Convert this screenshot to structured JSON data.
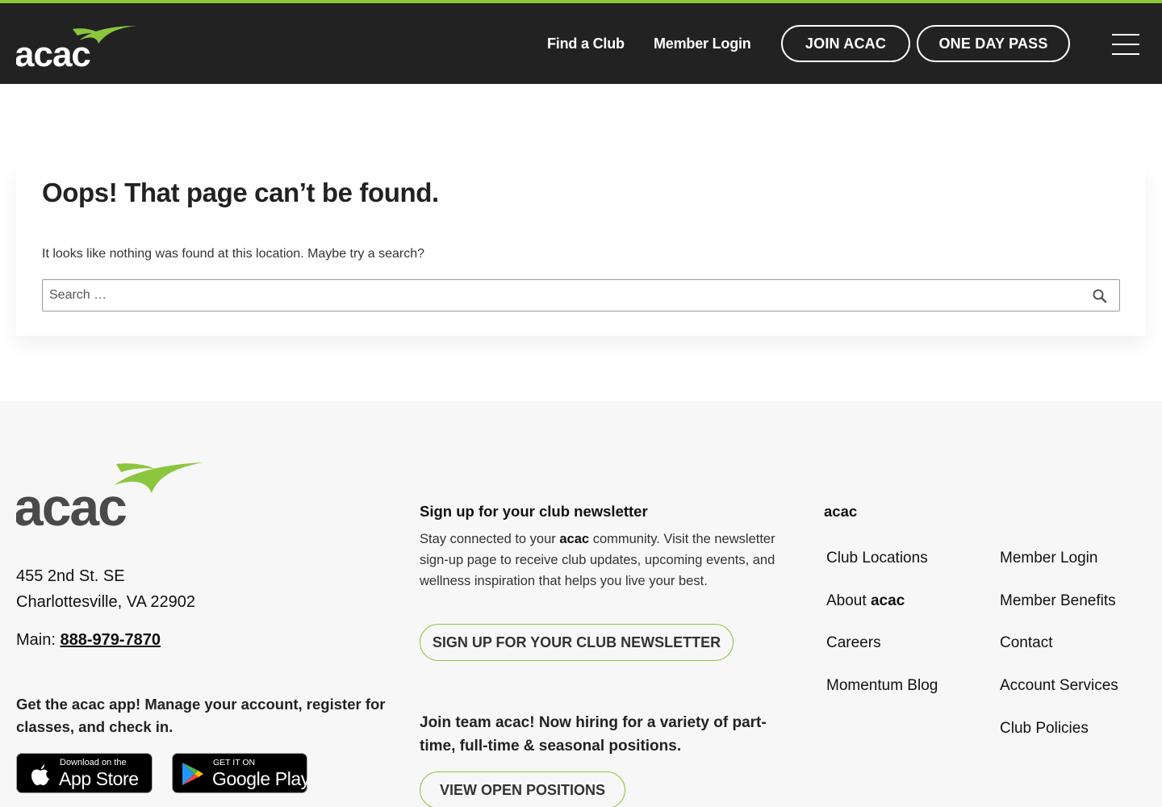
{
  "colors": {
    "brand_green": "#8cc63f",
    "header_bg": "#222222",
    "footer_bg": "#f7f7f7"
  },
  "header": {
    "logo_text": "acac",
    "nav": {
      "find_club": "Find a Club",
      "member_login": "Member Login"
    },
    "buttons": {
      "join": "JOIN ACAC",
      "one_day_pass": "ONE DAY PASS"
    },
    "menu_icon": "hamburger-menu-icon"
  },
  "main": {
    "title": "Oops! That page can’t be found.",
    "message": "It looks like nothing was found at this location. Maybe try a search?",
    "search": {
      "placeholder": "Search …",
      "icon": "search-icon"
    }
  },
  "footer": {
    "logo_text": "acac",
    "address": {
      "line1": "455 2nd St. SE",
      "line2": "Charlottesville, VA 22902"
    },
    "phone": {
      "label": "Main:",
      "number": "888-979-7870"
    },
    "app_text": "Get the acac app! Manage your account, register for classes, and check in.",
    "app_store": {
      "small": "Download on the",
      "big": "App Store",
      "icon": "apple-icon"
    },
    "google_play": {
      "small": "GET IT ON",
      "big": "Google Play",
      "icon": "google-play-icon"
    },
    "newsletter": {
      "heading": "Sign up for your club newsletter",
      "text_before": "Stay connected to your",
      "text_brand": "acac",
      "text_after": "community. Visit the newsletter sign-up page to receive club updates, upcoming events, and wellness inspiration that helps you live your best.",
      "button": "SIGN UP FOR YOUR CLUB NEWSLETTER"
    },
    "hiring": {
      "text": "Join team acac! Now hiring for a variety of part-time, full-time & seasonal positions.",
      "button": "VIEW OPEN POSITIONS"
    },
    "links_heading": "acac",
    "links_col1": [
      "Club Locations",
      "About",
      "Careers",
      "Momentum Blog"
    ],
    "about_brand": "acac",
    "links_col2": [
      "Member Login",
      "Member Benefits",
      "Contact",
      "Account Services",
      "Club Policies"
    ]
  }
}
